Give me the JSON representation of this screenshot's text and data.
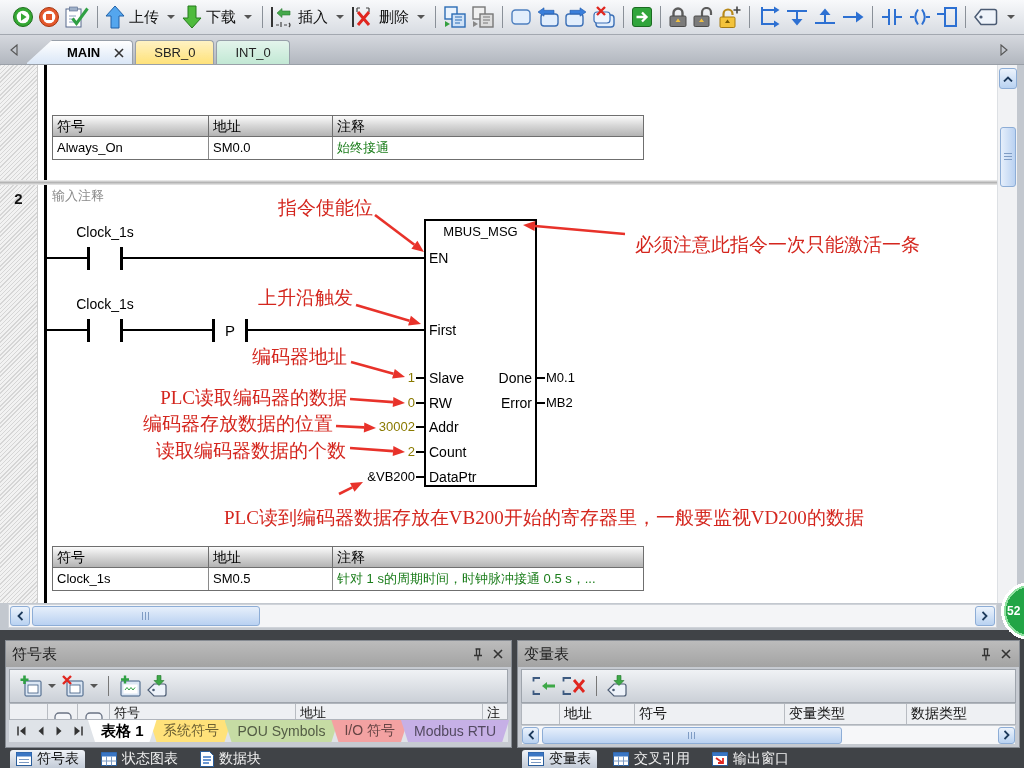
{
  "toolbar": {
    "buttons": [
      {
        "label": "上传"
      },
      {
        "label": "下载"
      },
      {
        "label": "插入"
      },
      {
        "label": "删除"
      }
    ]
  },
  "editor_tabs": [
    {
      "label": "MAIN",
      "selected": true,
      "color": "#ffffff"
    },
    {
      "label": "SBR_0",
      "selected": false,
      "color": "#ffe27a"
    },
    {
      "label": "INT_0",
      "selected": false,
      "color": "#c2e8d4"
    }
  ],
  "networks": [
    {
      "symbols": {
        "columns": [
          "符号",
          "地址",
          "注释"
        ],
        "rows": [
          [
            "Always_On",
            "SM0.0",
            "始终接通"
          ]
        ]
      }
    },
    {
      "number": "2",
      "comment": "输入注释",
      "ladder": {
        "rungs": [
          {
            "elements": [
              {
                "kind": "contact",
                "label": "Clock_1s"
              }
            ]
          },
          {
            "elements": [
              {
                "kind": "contact",
                "label": "Clock_1s"
              },
              {
                "kind": "edge",
                "symbol": "P"
              }
            ]
          }
        ],
        "block": {
          "title": "MBUS_MSG",
          "inputs": [
            {
              "pin": "EN",
              "kind": "rung"
            },
            {
              "pin": "First",
              "kind": "rung"
            },
            {
              "pin": "Slave",
              "kind": "constant",
              "value": "1"
            },
            {
              "pin": "RW",
              "kind": "constant",
              "value": "0"
            },
            {
              "pin": "Addr",
              "kind": "constant",
              "value": "30002"
            },
            {
              "pin": "Count",
              "kind": "constant",
              "value": "2"
            },
            {
              "pin": "DataPtr",
              "kind": "address",
              "value": "&VB200"
            }
          ],
          "outputs": [
            {
              "pin": "Done",
              "value": "M0.1"
            },
            {
              "pin": "Error",
              "value": "MB2"
            }
          ]
        },
        "annotations": [
          {
            "kind": "callout",
            "text": "指令使能位"
          },
          {
            "kind": "callout",
            "text": "必须注意此指令一次只能激活一条"
          },
          {
            "kind": "callout",
            "text": "上升沿触发"
          },
          {
            "kind": "callout",
            "text": "编码器地址"
          },
          {
            "kind": "callout",
            "text": "PLC读取编码器的数据"
          },
          {
            "kind": "callout",
            "text": "编码器存放数据的位置"
          },
          {
            "kind": "callout",
            "text": "读取编码器数据的个数"
          },
          {
            "kind": "arrow"
          },
          {
            "kind": "note",
            "text": "PLC读到编码器数据存放在VB200开始的寄存器里，一般要监视VD200的数据"
          }
        ]
      },
      "symbols": {
        "columns": [
          "符号",
          "地址",
          "注释"
        ],
        "rows": [
          [
            "Clock_1s",
            "SM0.5",
            "针对 1 s的周期时间，时钟脉冲接通 0.5 s，..."
          ]
        ]
      }
    }
  ],
  "dock_panels": [
    {
      "kind": "symbols",
      "title": "符号表",
      "columns": [
        "符号",
        "地址",
        "注"
      ],
      "sheet_tabs": [
        {
          "label": "表格 1",
          "selected": true,
          "color": "#ffffff"
        },
        {
          "label": "系统符号",
          "selected": false,
          "color": "#ffe27a"
        },
        {
          "label": "POU Symbols",
          "selected": false,
          "color": "#c6dca4"
        },
        {
          "label": "I/O 符号",
          "selected": false,
          "color": "#f3a2a2"
        },
        {
          "label": "Modbus RTU",
          "selected": false,
          "color": "#c6b0e6"
        }
      ],
      "dock_tabs": [
        {
          "label": "符号表",
          "selected": true
        },
        {
          "label": "状态图表",
          "selected": false
        },
        {
          "label": "数据块",
          "selected": false
        }
      ]
    },
    {
      "kind": "variables",
      "title": "变量表",
      "columns": [
        "地址",
        "符号",
        "变量类型",
        "数据类型"
      ],
      "dock_tabs": [
        {
          "label": "变量表",
          "selected": true
        },
        {
          "label": "交叉引用",
          "selected": false
        },
        {
          "label": "输出窗口",
          "selected": false
        }
      ]
    }
  ],
  "floating_badge": "52"
}
